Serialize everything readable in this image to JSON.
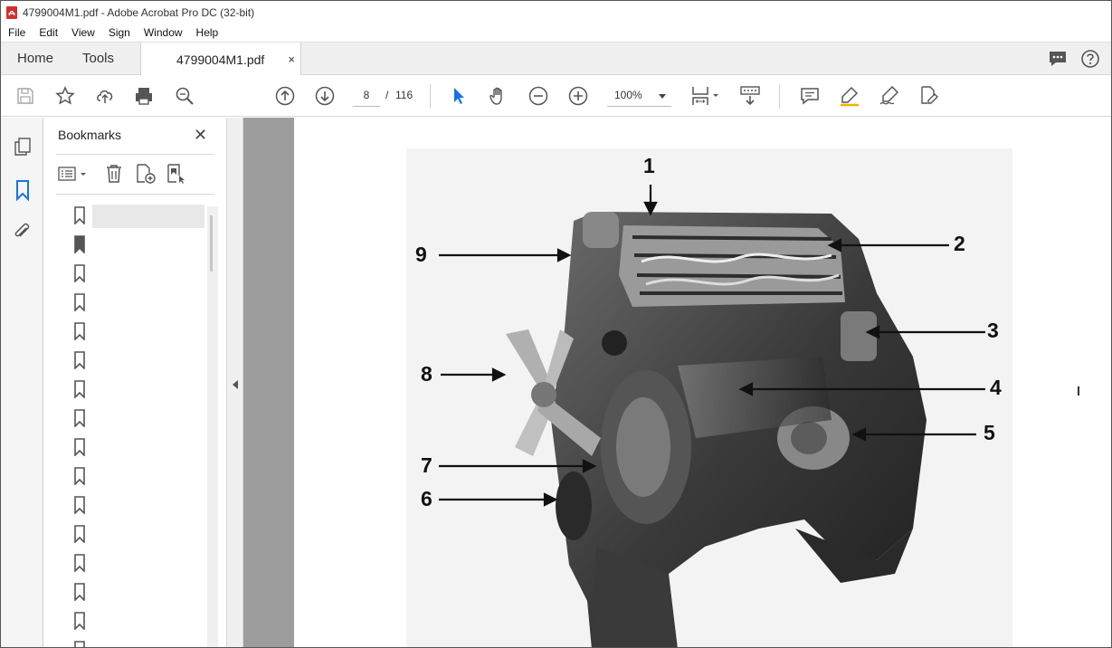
{
  "window": {
    "title": "4799004M1.pdf - Adobe Acrobat Pro DC (32-bit)"
  },
  "menu": [
    "File",
    "Edit",
    "View",
    "Sign",
    "Window",
    "Help"
  ],
  "tabs": {
    "home": "Home",
    "tools": "Tools",
    "document": "4799004M1.pdf",
    "close_glyph": "×"
  },
  "toolbar": {
    "page_current": "8",
    "page_separator": "/",
    "page_total": "116",
    "zoom": "100%"
  },
  "bookmarks": {
    "title": "Bookmarks",
    "close_glyph": "✕",
    "items": [
      "",
      "",
      "",
      "",
      "",
      "",
      "",
      "",
      "",
      "",
      "",
      "",
      "",
      "",
      "",
      ""
    ],
    "selected_index": 0
  },
  "document": {
    "callouts": [
      "1",
      "2",
      "3",
      "4",
      "5",
      "6",
      "7",
      "8",
      "9"
    ]
  },
  "colors": {
    "accent": "#1473e6",
    "icon": "#555555",
    "canvas": "#9d9d9d",
    "tab_bg": "#f0f0f0"
  }
}
